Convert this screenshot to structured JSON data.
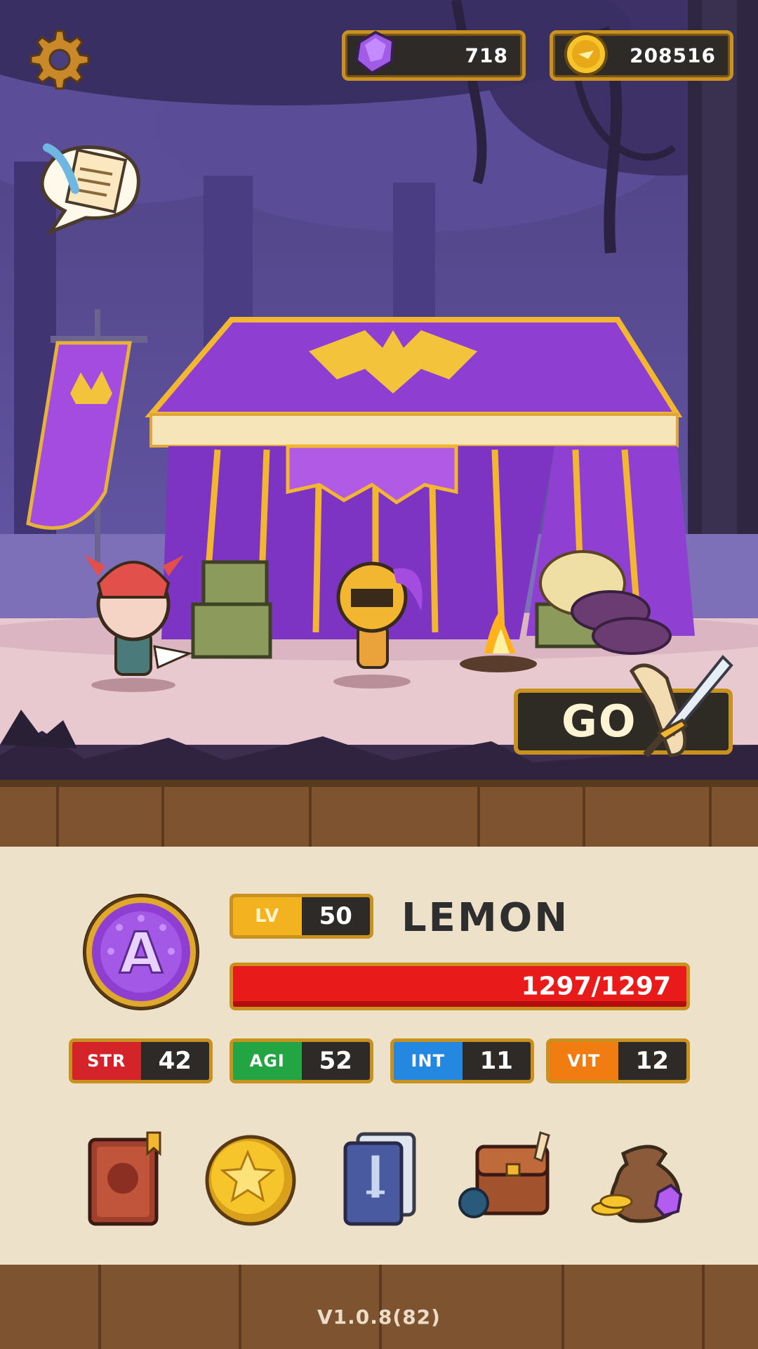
{
  "currencies": {
    "gems": {
      "amount": "718",
      "icon": "gem-icon"
    },
    "gold": {
      "amount": "208516",
      "icon": "gold-coin-icon"
    }
  },
  "actions": {
    "go_label": "GO"
  },
  "hero": {
    "name": "LEMON",
    "level_label": "LV",
    "level": "50",
    "hp_text": "1297/1297",
    "hp_fraction": 1.0,
    "rank_emblem_letter": "A",
    "stats": [
      {
        "label": "STR",
        "value": "42",
        "color": "#d4242a"
      },
      {
        "label": "AGI",
        "value": "52",
        "color": "#24a544"
      },
      {
        "label": "INT",
        "value": "11",
        "color": "#2487e0"
      },
      {
        "label": "VIT",
        "value": "12",
        "color": "#f07c12"
      }
    ]
  },
  "menu": [
    {
      "icon": "hero-book-icon"
    },
    {
      "icon": "star-coin-icon"
    },
    {
      "icon": "card-deck-icon"
    },
    {
      "icon": "inventory-bag-icon"
    },
    {
      "icon": "treasure-sack-icon"
    }
  ],
  "version": "V1.0.8(82)",
  "colors": {
    "gold_border": "#c9921f",
    "panel": "#ede1c9",
    "hp_red": "#e81a1a",
    "tent_purple": "#8e3fd1"
  }
}
